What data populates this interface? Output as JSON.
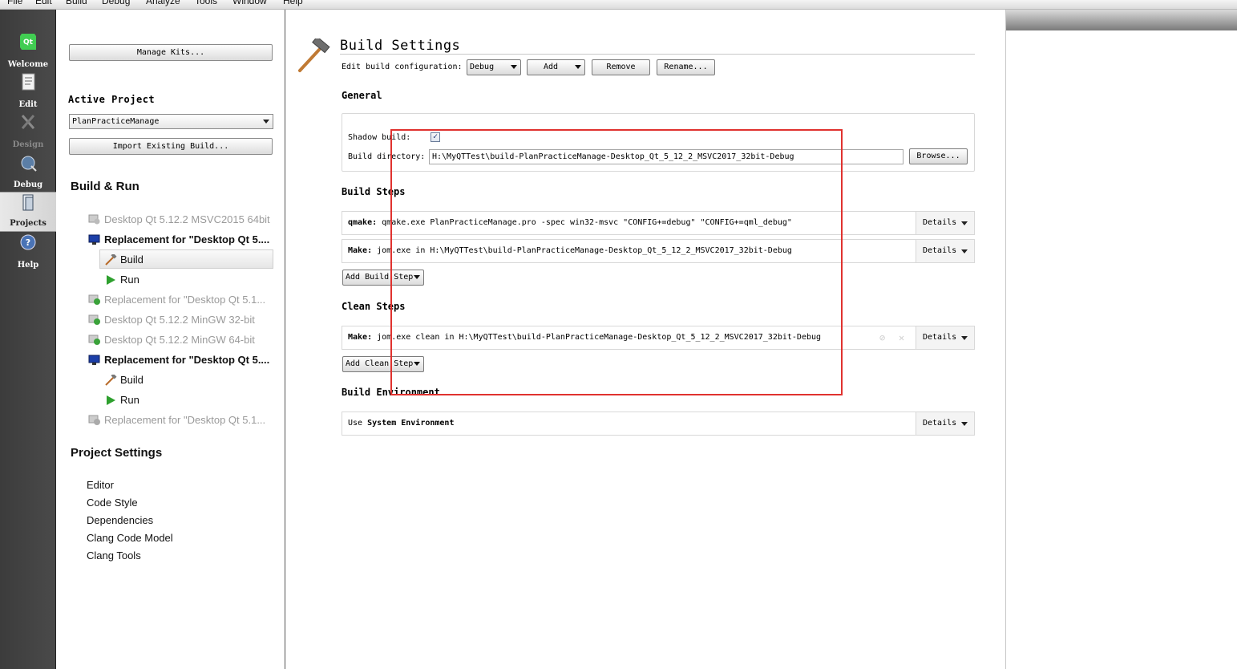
{
  "menu": [
    "File",
    "Edit",
    "Build",
    "Debug",
    "Analyze",
    "Tools",
    "Window",
    "Help"
  ],
  "modes": [
    {
      "label": "Welcome",
      "icon": "qt-logo-icon"
    },
    {
      "label": "Edit",
      "icon": "edit-document-icon"
    },
    {
      "label": "Design",
      "icon": "design-pen-icon"
    },
    {
      "label": "Debug",
      "icon": "debug-bug-icon"
    },
    {
      "label": "Projects",
      "icon": "projects-folder-icon"
    },
    {
      "label": "Help",
      "icon": "help-question-icon"
    }
  ],
  "nav": {
    "manage_kits": "Manage Kits...",
    "active_project_heading": "Active Project",
    "active_project": "PlanPracticeManage",
    "import_build": "Import Existing Build...",
    "build_run_heading": "Build & Run",
    "kits": [
      {
        "label": "Desktop Qt 5.12.2 MSVC2015 64bit",
        "state": "dim"
      },
      {
        "label": "Replacement for \"Desktop Qt 5....",
        "state": "bold"
      },
      {
        "label": "Build",
        "state": "sub-selected"
      },
      {
        "label": "Run",
        "state": "sub"
      },
      {
        "label": "Replacement for \"Desktop Qt 5.1...",
        "state": "dim"
      },
      {
        "label": "Desktop Qt 5.12.2 MinGW 32-bit",
        "state": "dim"
      },
      {
        "label": "Desktop Qt 5.12.2 MinGW 64-bit",
        "state": "dim"
      },
      {
        "label": "Replacement for \"Desktop Qt 5....",
        "state": "bold"
      },
      {
        "label": "Build",
        "state": "sub"
      },
      {
        "label": "Run",
        "state": "sub"
      },
      {
        "label": "Replacement for \"Desktop Qt 5.1...",
        "state": "dim"
      }
    ],
    "project_settings_heading": "Project Settings",
    "project_settings": [
      "Editor",
      "Code Style",
      "Dependencies",
      "Clang Code Model",
      "Clang Tools"
    ]
  },
  "main": {
    "title": "Build Settings",
    "edit_config_label": "Edit build configuration:",
    "config_value": "Debug",
    "add_label": "Add",
    "remove_label": "Remove",
    "rename_label": "Rename...",
    "general_heading": "General",
    "shadow_build_label": "Shadow build:",
    "shadow_build_checked": "✓",
    "build_dir_label": "Build directory:",
    "build_dir_value": "H:\\MyQTTest\\build-PlanPracticeManage-Desktop_Qt_5_12_2_MSVC2017_32bit-Debug",
    "browse_label": "Browse...",
    "build_steps_heading": "Build Steps",
    "build_steps": [
      {
        "name": "qmake:",
        "text": "qmake.exe PlanPracticeManage.pro -spec win32-msvc \"CONFIG+=debug\" \"CONFIG+=qml_debug\"",
        "details": "Details"
      },
      {
        "name": "Make:",
        "text": "jom.exe in H:\\MyQTTest\\build-PlanPracticeManage-Desktop_Qt_5_12_2_MSVC2017_32bit-Debug",
        "details": "Details"
      }
    ],
    "add_build_step": "Add Build Step",
    "clean_steps_heading": "Clean Steps",
    "clean_steps": [
      {
        "name": "Make:",
        "text": "jom.exe clean in H:\\MyQTTest\\build-PlanPracticeManage-Desktop_Qt_5_12_2_MSVC2017_32bit-Debug",
        "details": "Details"
      }
    ],
    "add_clean_step": "Add Clean Step",
    "build_env_heading": "Build Environment",
    "build_env_prefix": "Use",
    "build_env_value": "System Environment",
    "build_env_details": "Details"
  },
  "colors": {
    "annotation_red": "#e0322f",
    "mode_bar": "#404040"
  }
}
